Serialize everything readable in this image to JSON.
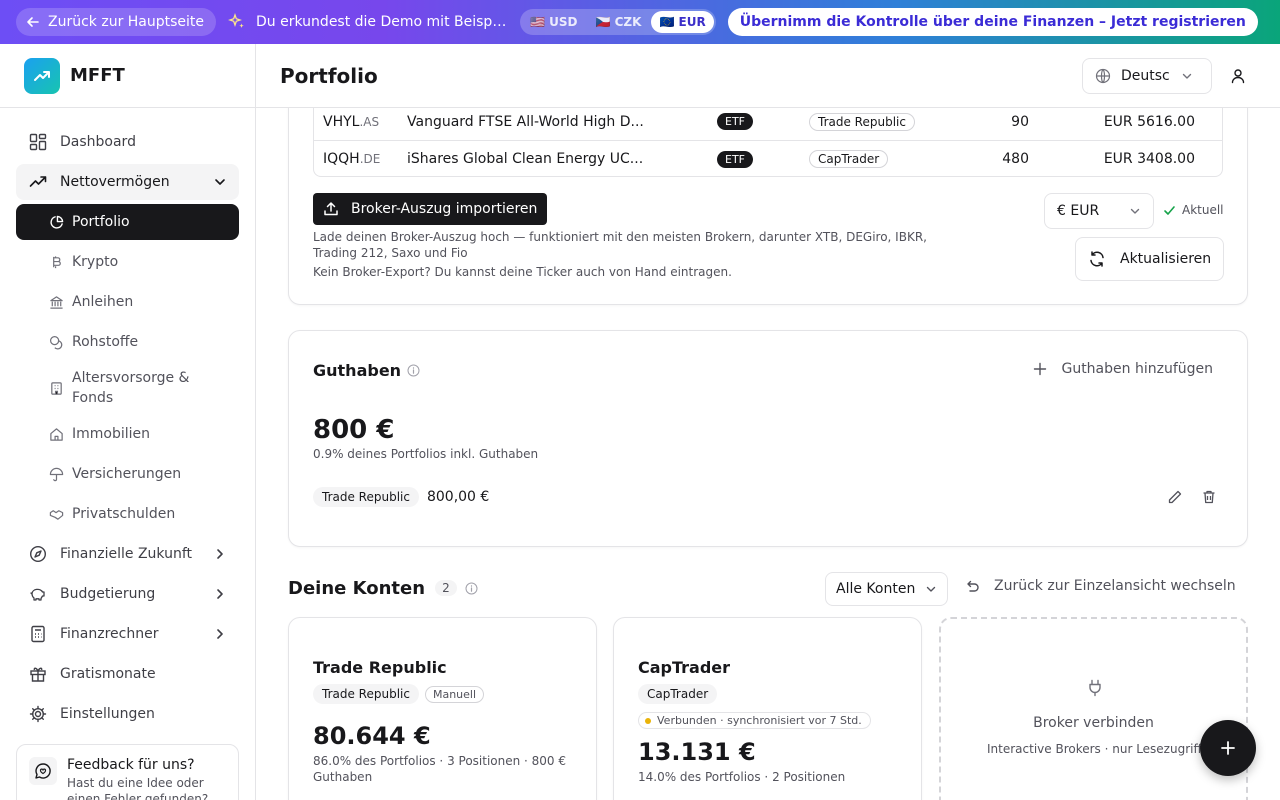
{
  "banner": {
    "back_label": "Zurück zur Hauptseite",
    "message": "Du erkundest die Demo mit Beispieldaten",
    "currencies": [
      {
        "label": "🇺🇸 USD",
        "active": false
      },
      {
        "label": "🇨🇿 CZK",
        "active": false
      },
      {
        "label": "🇪🇺 EUR",
        "active": true
      }
    ],
    "cta_label": "Übernimm die Kontrolle über deine Finanzen – Jetzt registrieren"
  },
  "brand": {
    "name": "MFFT"
  },
  "sidebar": {
    "items": [
      {
        "label": "Dashboard",
        "icon": "dashboard-icon"
      },
      {
        "label": "Nettovermögen",
        "icon": "trending-up-icon"
      },
      {
        "label": "Finanzielle Zukunft",
        "icon": "compass-icon"
      },
      {
        "label": "Budgetierung",
        "icon": "piggy-bank-icon"
      },
      {
        "label": "Finanzrechner",
        "icon": "calculator-icon"
      },
      {
        "label": "Gratismonate",
        "icon": "gift-icon"
      },
      {
        "label": "Einstellungen",
        "icon": "gear-icon"
      }
    ],
    "sub_items": [
      {
        "label": "Portfolio",
        "icon": "pie-chart-icon"
      },
      {
        "label": "Krypto",
        "icon": "bitcoin-icon"
      },
      {
        "label": "Anleihen",
        "icon": "bank-icon"
      },
      {
        "label": "Rohstoffe",
        "icon": "coins-icon"
      },
      {
        "label": "Altersvorsorge & Fonds",
        "icon": "building-icon"
      },
      {
        "label": "Immobilien",
        "icon": "home-icon"
      },
      {
        "label": "Versicherungen",
        "icon": "umbrella-icon"
      },
      {
        "label": "Privatschulden",
        "icon": "handshake-icon"
      }
    ],
    "feedback": {
      "title": "Feedback für uns?",
      "text": "Hast du eine Idee oder einen Fehler gefunden?"
    }
  },
  "header": {
    "title": "Portfolio",
    "language": "Deutsch"
  },
  "holdings": {
    "rows": [
      {
        "ticker": "VHYL",
        "exchange": ".AS",
        "name": "Vanguard FTSE All-World High D...",
        "type": "ETF",
        "broker": "Trade Republic",
        "qty": "90",
        "value": "EUR 5616.00"
      },
      {
        "ticker": "IQQH",
        "exchange": ".DE",
        "name": "iShares Global Clean Energy UC...",
        "type": "ETF",
        "broker": "CapTrader",
        "qty": "480",
        "value": "EUR 3408.00"
      }
    ],
    "import_label": "Broker-Auszug importieren",
    "import_help": "Lade deinen Broker-Auszug hoch — funktioniert mit den meisten Brokern, darunter XTB, DEGiro, IBKR, Trading 212, Saxo und Fio",
    "import_help2": "Kein Broker-Export? Du kannst deine Ticker auch von Hand eintragen.",
    "currency": "€ EUR",
    "status": "Aktuell",
    "refresh_label": "Aktualisieren"
  },
  "guthaben": {
    "title": "Guthaben",
    "add_label": "Guthaben hinzufügen",
    "amount": "800 €",
    "pct": "0.9% deines Portfolios inkl. Guthaben",
    "entry_broker": "Trade Republic",
    "entry_amount": "800,00 €"
  },
  "accounts": {
    "title": "Deine Konten",
    "count": "2",
    "filter": "Alle Konten",
    "back_label": "Zurück zur Einzelansicht wechseln",
    "cards": [
      {
        "name": "Trade Republic",
        "tag": "Trade Republic",
        "mode": "Manuell",
        "value": "80.644 €",
        "sub": "86.0% des Portfolios · 3 Positionen · 800 € Guthaben"
      },
      {
        "name": "CapTrader",
        "tag": "CapTrader",
        "connection": "Verbunden · synchronisiert vor 7 Std.",
        "value": "13.131 €",
        "sub": "14.0% des Portfolios · 2 Positionen"
      }
    ],
    "connect": {
      "title": "Broker verbinden",
      "sub": "Interactive Brokers · nur Lesezugriff"
    }
  },
  "colors": {
    "accent": "#18181b",
    "banner_start": "#6d4ef5",
    "banner_end": "#0aa57a",
    "status_ok": "#16a34a",
    "sync_dot": "#eab308"
  }
}
